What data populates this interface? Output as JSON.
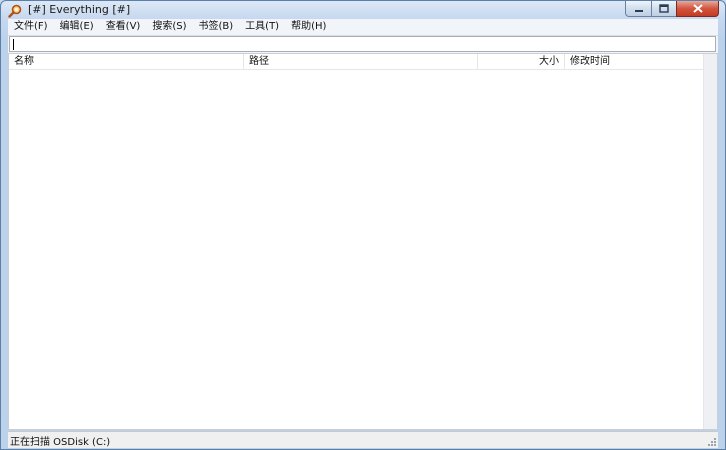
{
  "window": {
    "title": "[#] Everything [#]"
  },
  "menu": [
    {
      "label": "文件(F)"
    },
    {
      "label": "编辑(E)"
    },
    {
      "label": "查看(V)"
    },
    {
      "label": "搜索(S)"
    },
    {
      "label": "书签(B)"
    },
    {
      "label": "工具(T)"
    },
    {
      "label": "帮助(H)"
    }
  ],
  "search": {
    "value": "",
    "placeholder": ""
  },
  "columns": {
    "name": "名称",
    "path": "路径",
    "size": "大小",
    "modified": "修改时间"
  },
  "status": {
    "text": "正在扫描 OSDisk (C:)"
  },
  "colors": {
    "close_button": "#c43a22",
    "window_frame": "#bcd1ea"
  },
  "icons": {
    "app": "magnifier-icon"
  }
}
